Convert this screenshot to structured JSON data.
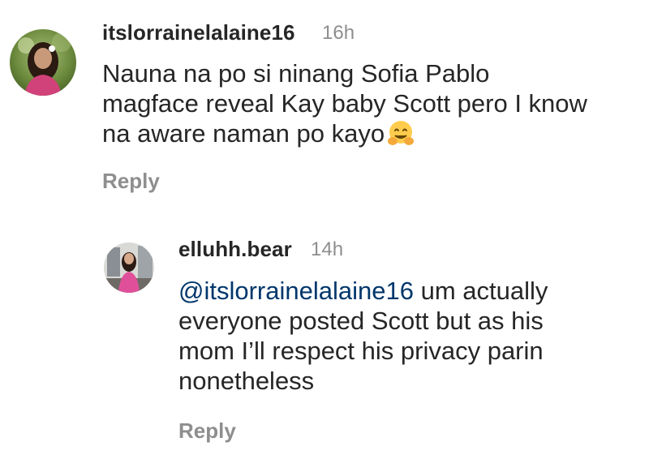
{
  "comment": {
    "username": "itslorrainelalaine16",
    "time": "16h",
    "lines": [
      "Nauna na po si ninang Sofia Pablo",
      "magface reveal Kay baby Scott pero I know",
      "na aware naman po kayo"
    ],
    "emoji": "hugging-face",
    "reply_label": "Reply"
  },
  "reply": {
    "username": "elluhh.bear",
    "time": "14h",
    "mention": "@itslorrainelalaine16",
    "line1_rest": " um actually",
    "lines": [
      "everyone posted Scott but as his",
      "mom I’ll respect his privacy parin",
      "nonetheless"
    ],
    "reply_label": "Reply"
  }
}
